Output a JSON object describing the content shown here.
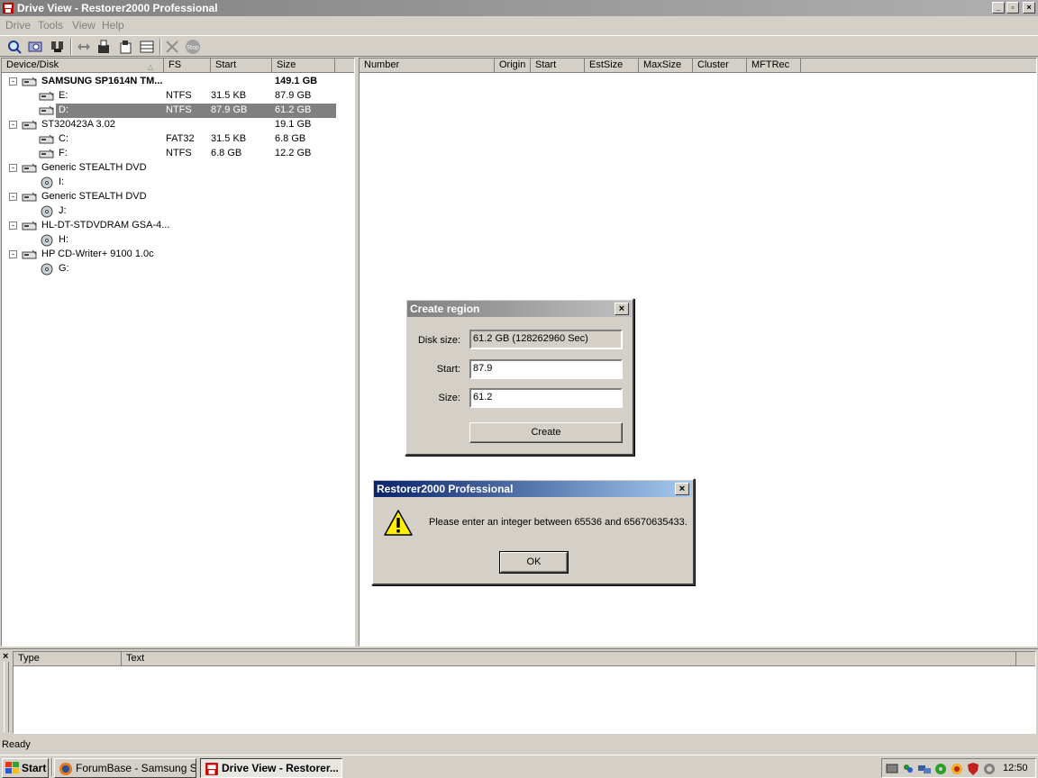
{
  "window": {
    "title": "Drive View - Restorer2000 Professional"
  },
  "menu": [
    "Drive",
    "Tools",
    "View",
    "Help"
  ],
  "toolbar": {
    "buttons": [
      "scan-drive-icon",
      "search-icon",
      "find-icon",
      "navigate-icon",
      "open-icon",
      "save-icon",
      "region-icon",
      "delete-icon",
      "stop-icon"
    ],
    "stop_label": "Stop"
  },
  "device_tree": {
    "columns": [
      "Device/Disk",
      "FS",
      "Start",
      "Size"
    ],
    "rows": [
      {
        "name": "SAMSUNG SP1614N TM...",
        "fs": "",
        "start": "",
        "size": "149.1 GB",
        "level": 0,
        "bold": true
      },
      {
        "name": "E:",
        "fs": "NTFS",
        "start": "31.5 KB",
        "size": "87.9 GB",
        "level": 1
      },
      {
        "name": "D:",
        "fs": "NTFS",
        "start": "87.9 GB",
        "size": "61.2 GB",
        "level": 1,
        "selected": true
      },
      {
        "name": "ST320423A 3.02",
        "fs": "",
        "start": "",
        "size": "19.1 GB",
        "level": 0
      },
      {
        "name": "C:",
        "fs": "FAT32",
        "start": "31.5 KB",
        "size": "6.8 GB",
        "level": 1
      },
      {
        "name": "F:",
        "fs": "NTFS",
        "start": "6.8 GB",
        "size": "12.2 GB",
        "level": 1
      },
      {
        "name": "Generic STEALTH DVD",
        "fs": "",
        "start": "",
        "size": "",
        "level": 0
      },
      {
        "name": "I:",
        "fs": "",
        "start": "",
        "size": "",
        "level": 1,
        "cd": true
      },
      {
        "name": "Generic STEALTH DVD",
        "fs": "",
        "start": "",
        "size": "",
        "level": 0
      },
      {
        "name": "J:",
        "fs": "",
        "start": "",
        "size": "",
        "level": 1,
        "cd": true
      },
      {
        "name": "HL-DT-STDVDRAM GSA-4...",
        "fs": "",
        "start": "",
        "size": "",
        "level": 0
      },
      {
        "name": "H:",
        "fs": "",
        "start": "",
        "size": "",
        "level": 1,
        "cd": true
      },
      {
        "name": "HP CD-Writer+ 9100 1.0c",
        "fs": "",
        "start": "",
        "size": "",
        "level": 0
      },
      {
        "name": "G:",
        "fs": "",
        "start": "",
        "size": "",
        "level": 1,
        "cd": true
      }
    ]
  },
  "partition_list": {
    "columns": [
      "Number",
      "Origin",
      "Start",
      "EstSize",
      "MaxSize",
      "Cluster",
      "MFTRec"
    ]
  },
  "log": {
    "columns": [
      "Type",
      "Text"
    ]
  },
  "status": {
    "text": "Ready"
  },
  "create_region_dialog": {
    "title": "Create region",
    "disk_size_label": "Disk size:",
    "disk_size_value": "61.2 GB (128262960 Sec)",
    "start_label": "Start:",
    "start_value": "87.9",
    "size_label": "Size:",
    "size_value": "61.2",
    "create_button": "Create"
  },
  "error_dialog": {
    "title": "Restorer2000 Professional",
    "message": "Please enter an integer between 65536 and 65670635433.",
    "ok_button": "OK"
  },
  "taskbar": {
    "start_label": "Start",
    "tasks": [
      "ForumBase - Samsung S...",
      "Drive View - Restorer..."
    ],
    "clock": "12:50"
  },
  "colors": {
    "selection": "#808080",
    "active_title": "#0a246a",
    "inactive_title": "#808080"
  }
}
